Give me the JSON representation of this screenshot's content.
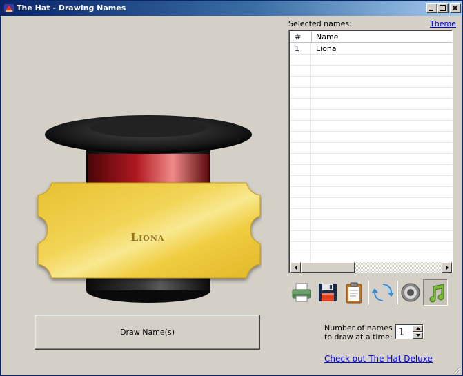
{
  "window": {
    "title": "The Hat - Drawing Names",
    "controls": [
      "minimize-icon",
      "maximize-icon",
      "close-icon"
    ]
  },
  "hat": {
    "ticket_name": "Liona",
    "colors": {
      "hat": "#1a1a1a",
      "band": "#b01820",
      "ticket": "#f0cc40"
    }
  },
  "draw_button": {
    "label": "Draw Name(s)"
  },
  "selected": {
    "label": "Selected names:",
    "theme_link": "Theme",
    "columns": [
      "#",
      "Name"
    ],
    "rows": [
      {
        "num": "1",
        "name": "Liona"
      }
    ]
  },
  "toolbar": {
    "icons": [
      "print-icon",
      "save-icon",
      "clipboard-icon",
      "refresh-icon",
      "sound-icon",
      "music-icon"
    ],
    "active": "music-icon"
  },
  "draw_count": {
    "label_line1": "Number of names",
    "label_line2": "to draw at a time:",
    "value": "1"
  },
  "deluxe_link": "Check out The Hat Deluxe"
}
